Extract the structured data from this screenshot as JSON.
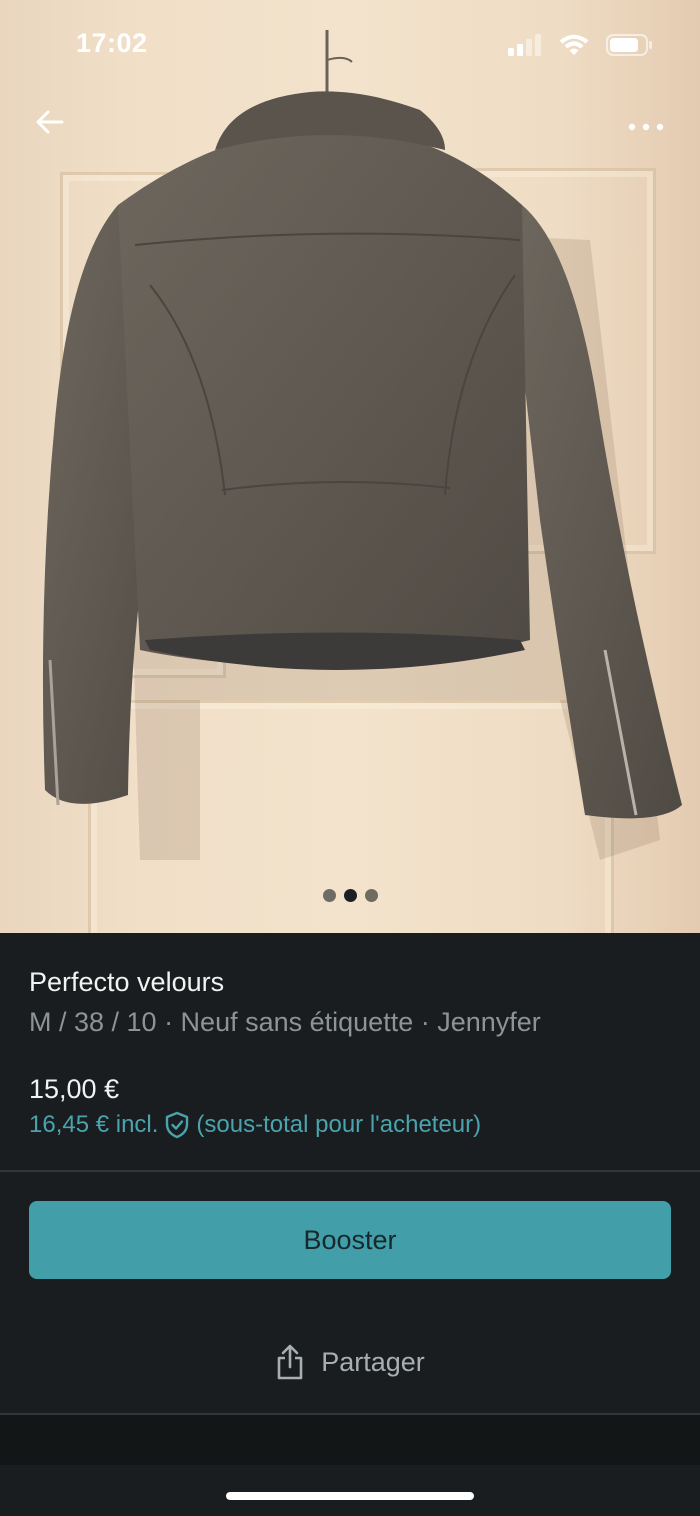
{
  "status_bar": {
    "time": "17:02"
  },
  "listing": {
    "title": "Perfecto velours",
    "details": "M / 38 / 10 · Neuf sans étiquette · Jennyfer",
    "price": "15,00 €",
    "price_incl": "16,45 € incl.",
    "price_incl_note": "(sous-total pour l'acheteur)"
  },
  "gallery": {
    "image_count": 3,
    "active_index": 1
  },
  "actions": {
    "booster_label": "Booster",
    "share_label": "Partager"
  },
  "colors": {
    "accent": "#429ea9",
    "background": "#1a1d1f",
    "link": "#4aa3ad"
  }
}
